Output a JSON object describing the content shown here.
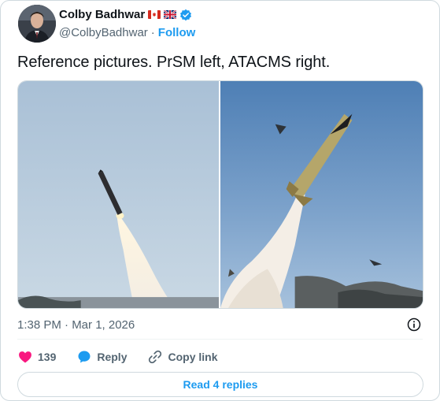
{
  "author": {
    "display_name": "Colby Badhwar",
    "handle": "@ColbyBadhwar",
    "separator": "·",
    "follow_label": "Follow",
    "flags": [
      "canada-flag-icon",
      "uk-flag-icon"
    ],
    "verified_icon": "verified-badge-icon"
  },
  "tweet": {
    "text": "Reference pictures. PrSM left, ATACMS right.",
    "timestamp": "1:38 PM · Mar 1, 2026"
  },
  "media": {
    "images": [
      {
        "icon": "missile-launch-photo-left"
      },
      {
        "icon": "missile-launch-photo-right"
      }
    ]
  },
  "actions": {
    "like_count": "139",
    "reply_label": "Reply",
    "copy_link_label": "Copy link"
  },
  "replies_button_label": "Read 4 replies",
  "colors": {
    "accent": "#1d9bf0",
    "like": "#f91880",
    "text": "#0f1419",
    "muted": "#536471",
    "border": "#cfd9de"
  }
}
